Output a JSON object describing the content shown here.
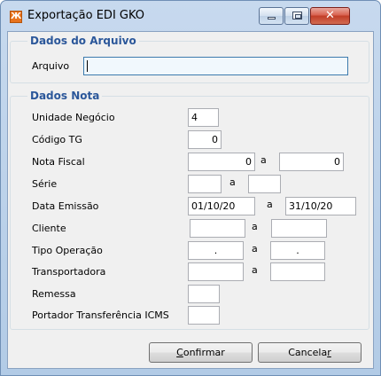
{
  "window": {
    "title": "Exportação EDI GKO",
    "app_icon_glyph": "Ж"
  },
  "caption_buttons": {
    "close_glyph": "✕"
  },
  "arquivo": {
    "legend": "Dados do Arquivo",
    "label": "Arquivo",
    "value": ""
  },
  "nota": {
    "legend": "Dados Nota",
    "unidade_negocio": {
      "label": "Unidade Negócio",
      "value": "4"
    },
    "codigo_tg": {
      "label": "Código TG",
      "value": "0"
    },
    "nota_fiscal": {
      "label": "Nota Fiscal",
      "from": "0",
      "sep": "a",
      "to": "0"
    },
    "serie": {
      "label": "Série",
      "from": "",
      "sep": "a",
      "to": ""
    },
    "data_emissao": {
      "label": "Data Emissão",
      "from": "01/10/20",
      "sep": "a",
      "to": "31/10/20"
    },
    "cliente": {
      "label": "Cliente",
      "from": "",
      "sep": "a",
      "to": ""
    },
    "tipo_operacao": {
      "label": "Tipo Operação",
      "from": ".",
      "sep": "a",
      "to": "."
    },
    "transportadora": {
      "label": "Transportadora",
      "from": "",
      "sep": "a",
      "to": ""
    },
    "remessa": {
      "label": "Remessa",
      "value": ""
    },
    "portador": {
      "label": "Portador Transferência ICMS",
      "value": ""
    }
  },
  "buttons": {
    "confirmar_hotkey": "C",
    "confirmar_rest": "onfirmar",
    "cancelar_start": "Cancela",
    "cancelar_hotkey": "r"
  },
  "colors": {
    "legend": "#2b579a",
    "frame": "#b9d1ea",
    "close": "#c94a35"
  }
}
